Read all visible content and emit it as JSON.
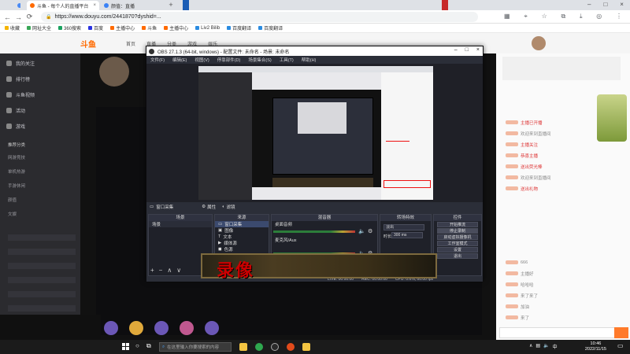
{
  "browser": {
    "tabs": [
      {
        "label": "斗鱼 - 每个人的直播平台",
        "active": true
      },
      {
        "label": "颜值：直播",
        "active": false
      }
    ],
    "new_tab_icon": "plus-icon",
    "url": "https://www.douyu.com/2441870?dyshid=...",
    "bookmarks": [
      "收藏",
      "网址大全",
      "360搜索",
      "百度",
      "主播中心",
      "斗鱼",
      "主播中心",
      "Liv2 Bilib",
      "百度翻译",
      "百度翻译"
    ]
  },
  "douyu": {
    "logo": "斗鱼",
    "nav": [
      "首页",
      "直播",
      "分类",
      "游戏",
      "娱乐"
    ],
    "sidebar": [
      {
        "label": "我的关注"
      },
      {
        "label": "排行榜"
      },
      {
        "label": "斗鱼视频"
      },
      {
        "label": "活动"
      },
      {
        "label": "游戏"
      }
    ],
    "sidebar_sections": [
      "推荐分类",
      "网游竞技",
      "单机热游",
      "手游休闲",
      "颜值",
      "文娱"
    ],
    "chat": [
      {
        "text": "主播已开播",
        "style": "red"
      },
      {
        "text": "欢迎来到直播间",
        "style": "gray"
      },
      {
        "text": "主播关注",
        "style": "red"
      },
      {
        "text": "恭喜主播",
        "style": "red"
      },
      {
        "text": "送出荧光棒",
        "style": "red"
      },
      {
        "text": "欢迎来到直播间",
        "style": "gray"
      },
      {
        "text": "送出礼物",
        "style": "red"
      },
      {
        "text": "666",
        "style": "gray"
      },
      {
        "text": "主播好",
        "style": "gray"
      },
      {
        "text": "哈哈哈",
        "style": "gray"
      },
      {
        "text": "来了来了",
        "style": "gray"
      },
      {
        "text": "加油",
        "style": "gray"
      },
      {
        "text": "来了",
        "style": "gray"
      }
    ]
  },
  "obs": {
    "title": "OBS 27.1.3 (64-bit, windows) - 配置文件: 未命名 - 场景: 未命名",
    "menu": [
      "文件(F)",
      "编辑(E)",
      "视图(V)",
      "停靠部件(D)",
      "场景集合(S)",
      "工具(T)",
      "帮助(H)"
    ],
    "source_toolbar": {
      "selected": "窗口采集",
      "props": "属性",
      "filters": "滤镜"
    },
    "docks": {
      "scenes": {
        "title": "场景",
        "items": [
          "场景"
        ]
      },
      "sources": {
        "title": "来源",
        "items": [
          "窗口采集",
          "图像",
          "文本",
          "媒体源",
          "色源"
        ]
      },
      "mixer": {
        "title": "混音器",
        "items": [
          "桌面音频",
          "麦克风/Aux"
        ]
      },
      "transitions": {
        "title": "转场特效",
        "type": "淡出",
        "duration_label": "时长",
        "duration": "300 ms"
      },
      "controls": {
        "title": "控件",
        "buttons": [
          "开始推流",
          "停止录制",
          "启动虚拟摄像机",
          "工作室模式",
          "设置",
          "退出"
        ]
      }
    },
    "status": {
      "live": "LIVE: 00:00:00",
      "rec": "REC: 00:00:00",
      "cpu": "CPU: 0.6%, 60.00 fps"
    }
  },
  "overlay": {
    "text": "录像"
  },
  "taskbar": {
    "search_placeholder": "在这里输入你要搜索的内容",
    "time": "10:46",
    "date": "2022/11/15"
  }
}
